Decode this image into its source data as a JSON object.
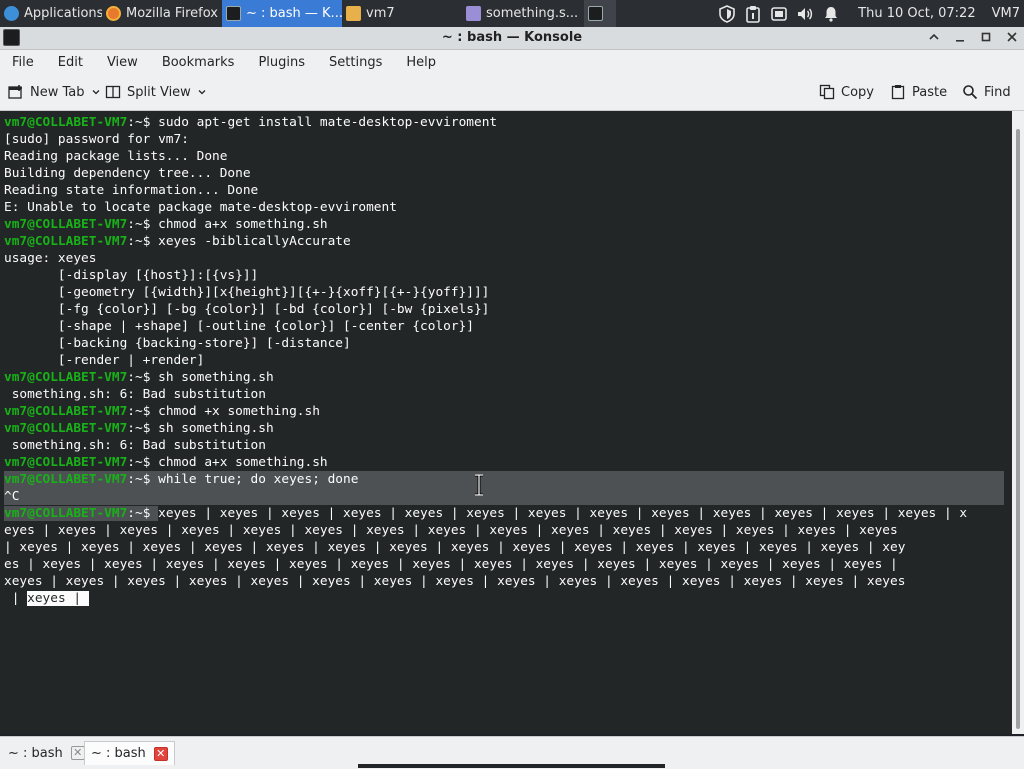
{
  "panel": {
    "tasks": [
      {
        "label": "Applications",
        "icon": "applications-menu-icon",
        "active": false
      },
      {
        "label": "Mozilla Firefox",
        "icon": "firefox-icon",
        "active": false
      },
      {
        "label": "~ : bash — K...",
        "icon": "terminal-icon",
        "active": true
      },
      {
        "label": "vm7",
        "icon": "folder-icon",
        "active": false
      },
      {
        "label": "something.s...",
        "icon": "text-editor-icon",
        "active": false
      }
    ],
    "clock": "Thu 10 Oct, 07:22",
    "user": "VM7"
  },
  "window": {
    "title": "~ : bash — Konsole",
    "menu": [
      "File",
      "Edit",
      "View",
      "Bookmarks",
      "Plugins",
      "Settings",
      "Help"
    ],
    "toolbar": {
      "new_tab": "New Tab",
      "split_view": "Split View",
      "copy": "Copy",
      "paste": "Paste",
      "find": "Find"
    }
  },
  "terminal": {
    "prompt": "vm7@COLLABET-VM7",
    "prompt_suffix": ":~$ ",
    "lines": [
      {
        "type": "cmd",
        "text": "sudo apt-get install mate-desktop-evviroment"
      },
      {
        "type": "out",
        "text": "[sudo] password for vm7:"
      },
      {
        "type": "out",
        "text": "Reading package lists... Done"
      },
      {
        "type": "out",
        "text": "Building dependency tree... Done"
      },
      {
        "type": "out",
        "text": "Reading state information... Done"
      },
      {
        "type": "out",
        "text": "E: Unable to locate package mate-desktop-evviroment"
      },
      {
        "type": "cmd",
        "text": "chmod a+x something.sh"
      },
      {
        "type": "cmd",
        "text": "xeyes -biblicallyAccurate"
      },
      {
        "type": "out",
        "text": "usage: xeyes"
      },
      {
        "type": "out",
        "text": "       [-display [{host}]:[{vs}]]"
      },
      {
        "type": "out",
        "text": "       [-geometry [{width}][x{height}][{+-}{xoff}[{+-}{yoff}]]]"
      },
      {
        "type": "out",
        "text": "       [-fg {color}] [-bg {color}] [-bd {color}] [-bw {pixels}]"
      },
      {
        "type": "out",
        "text": "       [-shape | +shape] [-outline {color}] [-center {color}]"
      },
      {
        "type": "out",
        "text": "       [-backing {backing-store}] [-distance]"
      },
      {
        "type": "out",
        "text": "       [-render | +render]"
      },
      {
        "type": "cmd",
        "text": "sh something.sh"
      },
      {
        "type": "out",
        "text": " something.sh: 6: Bad substitution"
      },
      {
        "type": "cmd",
        "text": "chmod +x something.sh"
      },
      {
        "type": "cmd",
        "text": "sh something.sh"
      },
      {
        "type": "out",
        "text": " something.sh: 6: Bad substitution"
      },
      {
        "type": "cmd",
        "text": "chmod a+x something.sh"
      },
      {
        "type": "cmd",
        "text": "while true; do xeyes; done",
        "highlight": true
      },
      {
        "type": "out",
        "text": "^C",
        "highlight": true
      },
      {
        "type": "cmd",
        "text": "xeyes | xeyes | xeyes | xeyes | xeyes | xeyes | xeyes | xeyes | xeyes | xeyes | xeyes | xeyes | xeyes | x",
        "highlight_prompt": true
      },
      {
        "type": "out",
        "text": "eyes | xeyes | xeyes | xeyes | xeyes | xeyes | xeyes | xeyes | xeyes | xeyes | xeyes | xeyes | xeyes | xeyes | xeyes"
      },
      {
        "type": "out",
        "text": "| xeyes | xeyes | xeyes | xeyes | xeyes | xeyes | xeyes | xeyes | xeyes | xeyes | xeyes | xeyes | xeyes | xeyes | xey"
      },
      {
        "type": "out",
        "text": "es | xeyes | xeyes | xeyes | xeyes | xeyes | xeyes | xeyes | xeyes | xeyes | xeyes | xeyes | xeyes | xeyes | xeyes |"
      },
      {
        "type": "out",
        "text": "xeyes | xeyes | xeyes | xeyes | xeyes | xeyes | xeyes | xeyes | xeyes | xeyes | xeyes | xeyes | xeyes | xeyes | xeyes"
      }
    ],
    "last_line_prefix": " | ",
    "last_line_selected": "xeyes | "
  },
  "tabs": [
    {
      "label": "~ : bash",
      "active": false
    },
    {
      "label": "~ : bash",
      "active": true
    }
  ],
  "colors": {
    "terminal_bg": "#232627",
    "terminal_fg": "#fcfcfc",
    "prompt": "#18b218",
    "active_task": "#3a7bd5",
    "close_tab": "#e2443b"
  }
}
